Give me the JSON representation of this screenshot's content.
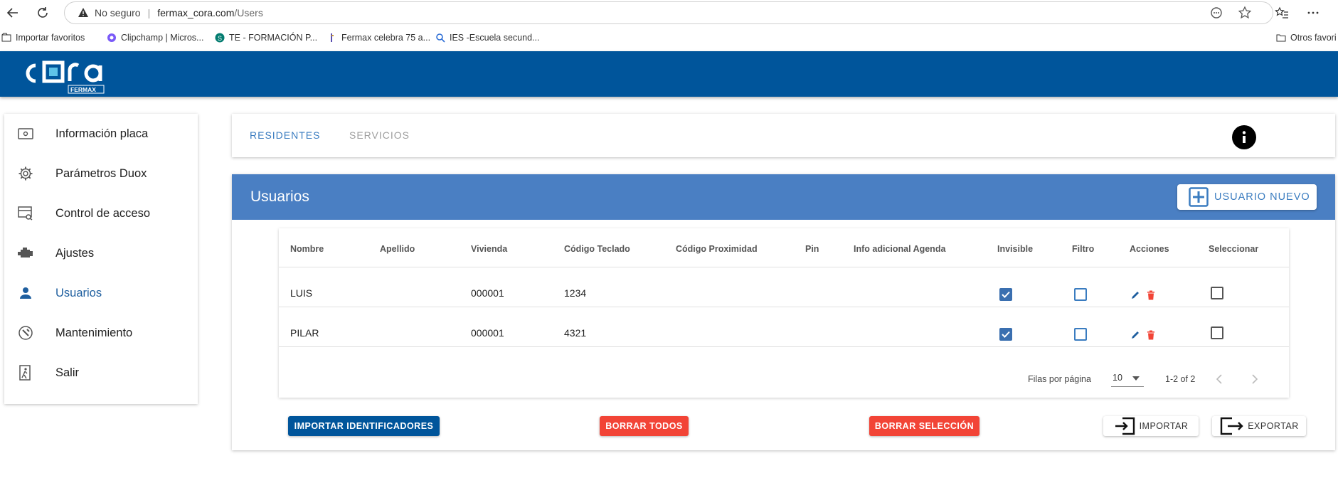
{
  "browser": {
    "security_label": "No seguro",
    "url_domain": "fermax_cora.com",
    "url_path": "/Users"
  },
  "bookmarks": {
    "items": [
      "Importar favoritos",
      "Clipchamp | Micros...",
      "TE - FORMACIÓN P...",
      "Fermax celebra 75 a...",
      "IES -Escuela secund..."
    ],
    "other": "Otros favori"
  },
  "logo": {
    "main": "cora",
    "sub": "FERMAX"
  },
  "sidebar": {
    "items": [
      {
        "label": "Información placa",
        "icon": "device-icon"
      },
      {
        "label": "Parámetros Duox",
        "icon": "gear-icon"
      },
      {
        "label": "Control de acceso",
        "icon": "access-icon"
      },
      {
        "label": "Ajustes",
        "icon": "engine-icon"
      },
      {
        "label": "Usuarios",
        "icon": "person-icon"
      },
      {
        "label": "Mantenimiento",
        "icon": "maintenance-icon"
      },
      {
        "label": "Salir",
        "icon": "exit-icon"
      }
    ],
    "active": "Usuarios"
  },
  "tabs": {
    "residentes": "RESIDENTES",
    "servicios": "SERVICIOS"
  },
  "users": {
    "title": "Usuarios",
    "new_user": "USUARIO NUEVO"
  },
  "table": {
    "headers": {
      "nombre": "Nombre",
      "apellido": "Apellido",
      "vivienda": "Vivienda",
      "codigo_teclado": "Código Teclado",
      "codigo_proximidad": "Código Proximidad",
      "pin": "Pin",
      "info": "Info adicional Agenda",
      "invisible": "Invisible",
      "filtro": "Filtro",
      "acciones": "Acciones",
      "seleccionar": "Seleccionar"
    },
    "rows": [
      {
        "nombre": "LUIS",
        "apellido": "",
        "vivienda": "000001",
        "codigo_teclado": "1234",
        "invisible": true,
        "filtro": false,
        "seleccionar": false
      },
      {
        "nombre": "PILAR",
        "apellido": "",
        "vivienda": "000001",
        "codigo_teclado": "4321",
        "invisible": true,
        "filtro": false,
        "seleccionar": false
      }
    ],
    "pagination": {
      "rows_label": "Filas por página",
      "rows_value": "10",
      "range": "1-2 of 2"
    }
  },
  "actions": {
    "import_ids": "IMPORTAR IDENTIFICADORES",
    "delete_all": "BORRAR TODOS",
    "delete_selection": "BORRAR SELECCIÓN",
    "import": "IMPORTAR",
    "export": "EXPORTAR"
  },
  "colors": {
    "brand_blue": "#00559b",
    "header_blue": "#4a7fc3",
    "accent": "#3a7cc0",
    "danger": "#f24436"
  }
}
